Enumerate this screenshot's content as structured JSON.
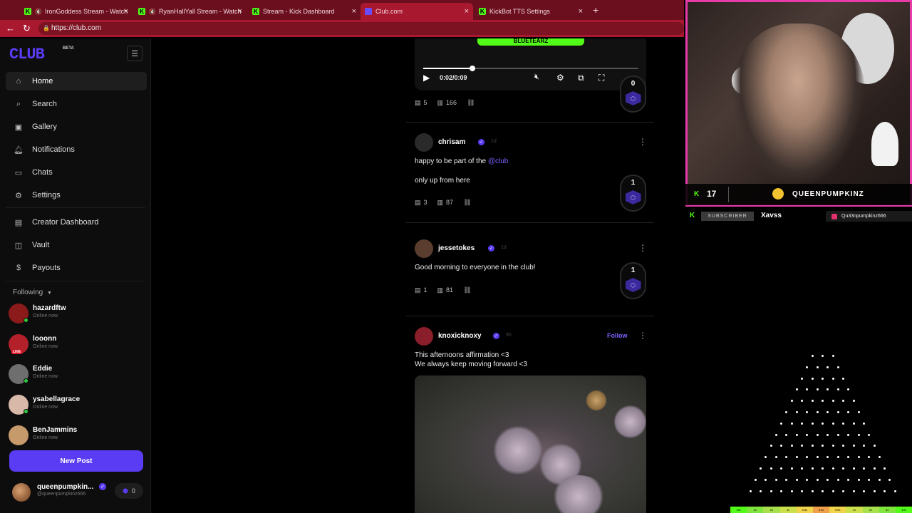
{
  "browser": {
    "tabs": [
      {
        "title": "IronGoddess Stream - Watch",
        "icon": "kick"
      },
      {
        "title": "RyanHallYall Stream - Watch",
        "icon": "kick"
      },
      {
        "title": "Stream - Kick Dashboard",
        "icon": "kick"
      },
      {
        "title": "Club.com",
        "icon": "club",
        "active": true
      },
      {
        "title": "KickBot TTS Settings",
        "icon": "kickbot"
      }
    ],
    "url": "https://club.com"
  },
  "sidebar": {
    "logo": "CLUB",
    "beta": "BETA",
    "nav": [
      {
        "label": "Home",
        "icon": "home-icon",
        "active": true
      },
      {
        "label": "Search",
        "icon": "search-icon"
      },
      {
        "label": "Gallery",
        "icon": "gallery-icon"
      },
      {
        "label": "Notifications",
        "icon": "bell-icon"
      },
      {
        "label": "Chats",
        "icon": "chat-icon"
      },
      {
        "label": "Settings",
        "icon": "gear-icon"
      }
    ],
    "nav2": [
      {
        "label": "Creator Dashboard",
        "icon": "dashboard-icon"
      },
      {
        "label": "Vault",
        "icon": "vault-icon"
      },
      {
        "label": "Payouts",
        "icon": "dollar-icon"
      }
    ],
    "following_label": "Following",
    "following": [
      {
        "name": "hazardftw",
        "status": "Online now",
        "color": "#8b1a1a"
      },
      {
        "name": "looonn",
        "status": "Online now",
        "color": "#b3202a",
        "live": "LIVE"
      },
      {
        "name": "Eddie",
        "status": "Online now",
        "color": "#6e6e6e"
      },
      {
        "name": "ysabellagrace",
        "status": "Online now",
        "color": "#d8b8a8"
      },
      {
        "name": "BenJammins",
        "status": "Online now",
        "color": "#c79a6b"
      }
    ],
    "new_post": "New Post",
    "user": {
      "name": "queenpumpkin...",
      "handle": "@queenpumpkinz666",
      "points": "0"
    }
  },
  "feed": {
    "video": {
      "banner": "BLUETEARZ",
      "time": "0:02/0:09",
      "progress": 0.23
    },
    "posts": [
      {
        "comments": "5",
        "views": "166",
        "votes": "0"
      },
      {
        "user": "chrisam",
        "time": "1d",
        "text1": "happy to be part of the ",
        "mention": "@club",
        "text2": "only up from here",
        "comments": "3",
        "views": "87",
        "votes": "1"
      },
      {
        "user": "jessetokes",
        "time": "1d",
        "text1": "Good morning to everyone in the club!",
        "comments": "1",
        "views": "81",
        "votes": "1"
      },
      {
        "user": "knoxicknoxy",
        "time": "6h",
        "follow": "Follow",
        "text1": "This afternoons affirmation <3",
        "text2": "We always keep moving forward <3"
      }
    ]
  },
  "stream": {
    "viewers": "17",
    "channel": "QUEENPUMPKINZ",
    "sub_label": "SUBSCRIBER",
    "sub_name": "Xavss",
    "instagram": "Qu33npumpkinz666",
    "slots": [
      "10x",
      "4x",
      "2x",
      "1x",
      "0.5x",
      "0.2x",
      "0.5x",
      "1x",
      "2x",
      "4x",
      "10x"
    ],
    "slot_colors": [
      "#53fc18",
      "#7fe53c",
      "#a6e04a",
      "#cbe04a",
      "#f0d44a",
      "#f0a04a",
      "#f0d44a",
      "#cbe04a",
      "#a6e04a",
      "#7fe53c",
      "#53fc18"
    ]
  }
}
